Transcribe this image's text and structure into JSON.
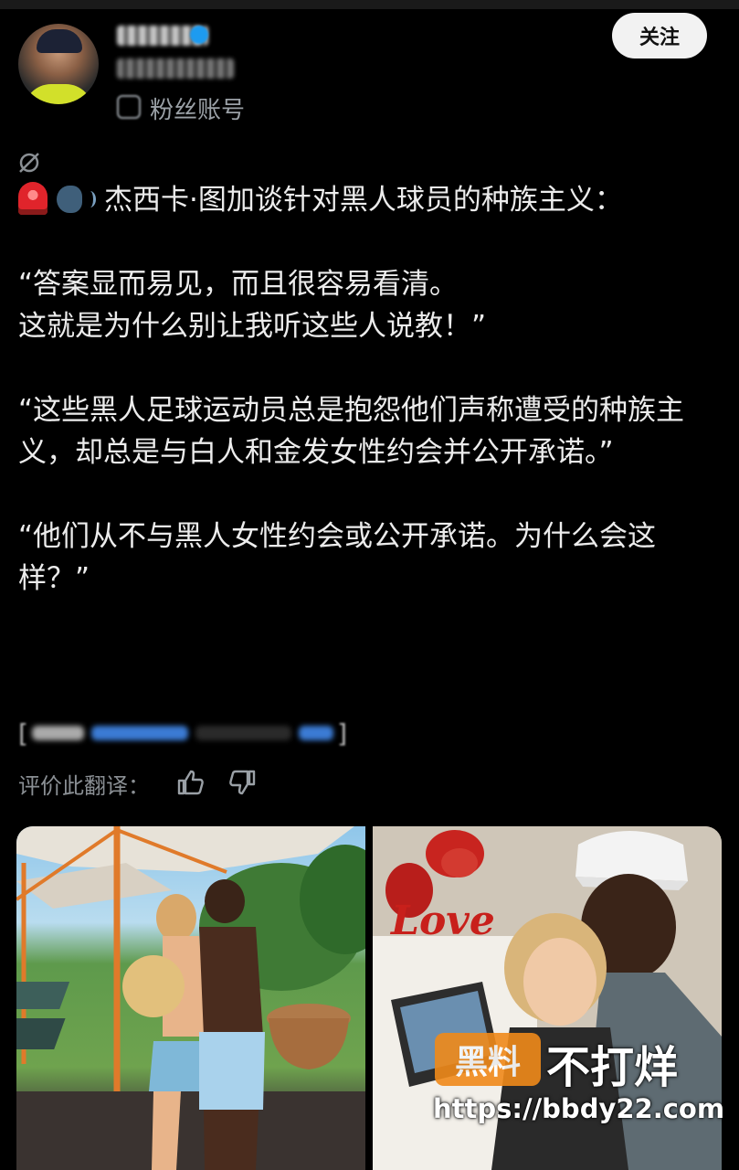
{
  "header": {
    "account_label": "粉丝账号",
    "follow_label": "关注"
  },
  "post": {
    "line1": "杰西卡·图加谈针对黑人球员的种族主义：",
    "quote1_a": "“答案显而易见，而且很容易看清。",
    "quote1_b": "这就是为什么别让我听这些人说教！”",
    "quote2": "“这些黑人足球运动员总是抱怨他们声称遭受的种族主义，却总是与白人和金发女性约会并公开承诺。”",
    "quote3": "“他们从不与黑人女性约会或公开承诺。为什么会这样？”"
  },
  "rating": {
    "label": "评价此翻译："
  },
  "watermark": {
    "logo_text": "黑料",
    "brand": "不打烊",
    "url": "https://bbdy22.com"
  },
  "photo_right": {
    "balloon_text": "Love"
  },
  "icons": {
    "emoji1": "siren-icon",
    "emoji2": "speaking-head-icon"
  }
}
